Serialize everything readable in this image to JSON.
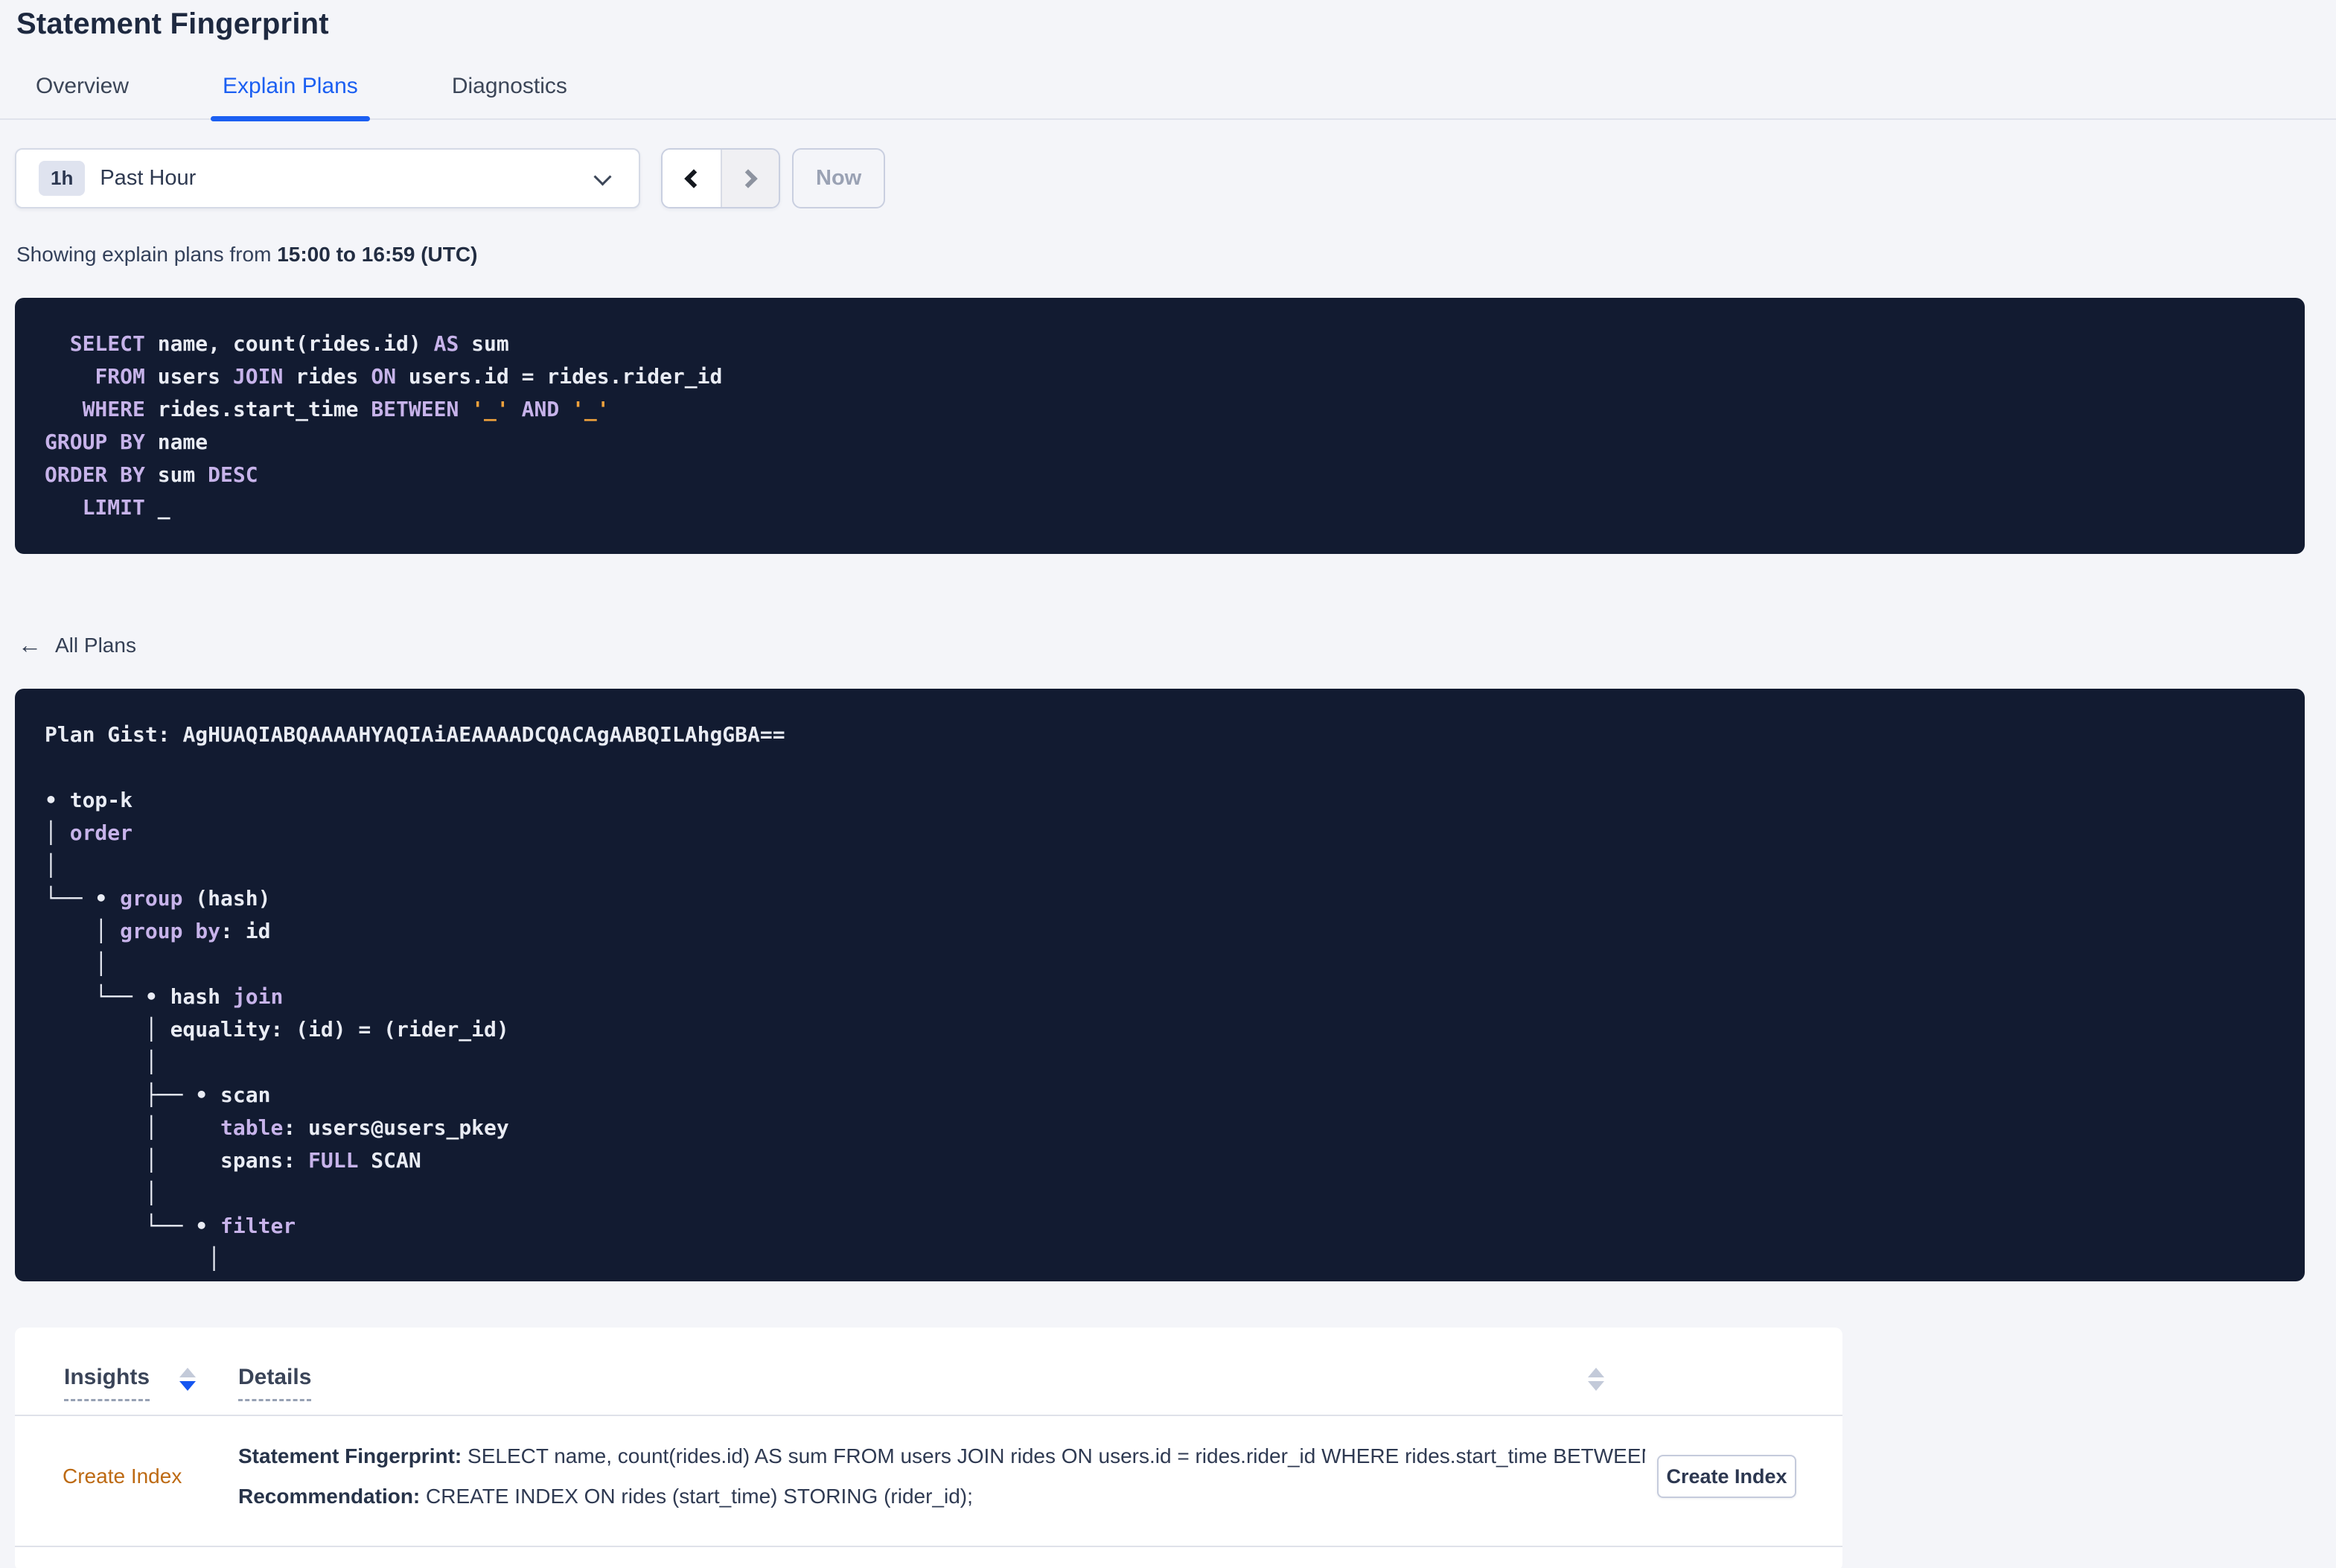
{
  "colors": {
    "accent_blue": "#1b5ff2",
    "panel_bg": "#121b31",
    "keyword_purple": "#c7b3ea",
    "literal_orange": "#f0a23c",
    "insight_orange": "#bd6a13"
  },
  "header": {
    "title": "Statement Fingerprint"
  },
  "tabs": [
    {
      "label": "Overview",
      "active": false
    },
    {
      "label": "Explain Plans",
      "active": true
    },
    {
      "label": "Diagnostics",
      "active": false
    }
  ],
  "time_selector": {
    "badge": "1h",
    "label": "Past Hour",
    "prev_label": "previous time interval",
    "next_label": "next time interval",
    "now_label": "Now"
  },
  "caption": {
    "prefix": "Showing explain plans from ",
    "range": "15:00 to 16:59 (UTC)"
  },
  "sql": {
    "lines": [
      [
        [
          "t",
          "  "
        ],
        [
          "k",
          "SELECT"
        ],
        [
          "t",
          " name, count(rides.id) "
        ],
        [
          "k",
          "AS"
        ],
        [
          "t",
          " sum"
        ]
      ],
      [
        [
          "t",
          "    "
        ],
        [
          "k",
          "FROM"
        ],
        [
          "t",
          " users "
        ],
        [
          "k",
          "JOIN"
        ],
        [
          "t",
          " rides "
        ],
        [
          "k",
          "ON"
        ],
        [
          "t",
          " users.id = rides.rider_id"
        ]
      ],
      [
        [
          "t",
          "   "
        ],
        [
          "k",
          "WHERE"
        ],
        [
          "t",
          " rides.start_time "
        ],
        [
          "k",
          "BETWEEN"
        ],
        [
          "t",
          " "
        ],
        [
          "s",
          "'_'"
        ],
        [
          "t",
          " "
        ],
        [
          "k",
          "AND"
        ],
        [
          "t",
          " "
        ],
        [
          "s",
          "'_'"
        ]
      ],
      [
        [
          "k",
          "GROUP BY"
        ],
        [
          "t",
          " name"
        ]
      ],
      [
        [
          "k",
          "ORDER BY"
        ],
        [
          "t",
          " sum "
        ],
        [
          "k",
          "DESC"
        ]
      ],
      [
        [
          "t",
          "   "
        ],
        [
          "k",
          "LIMIT"
        ],
        [
          "t",
          " _"
        ]
      ]
    ]
  },
  "all_plans": {
    "label": "All Plans"
  },
  "plan": {
    "gist_label": "Plan Gist: ",
    "gist_value": "AgHUAQIABQAAAAHYAQIAiAEAAAADCQACAgAABQILAhgGBA==",
    "tree_lines": [
      [
        [
          "t",
          "• top-k"
        ]
      ],
      [
        [
          "t",
          "│ "
        ],
        [
          "k",
          "order"
        ]
      ],
      [
        [
          "t",
          "│"
        ]
      ],
      [
        [
          "t",
          "└── • "
        ],
        [
          "k",
          "group"
        ],
        [
          "t",
          " (hash)"
        ]
      ],
      [
        [
          "t",
          "    │ "
        ],
        [
          "k",
          "group by"
        ],
        [
          "t",
          ": id"
        ]
      ],
      [
        [
          "t",
          "    │"
        ]
      ],
      [
        [
          "t",
          "    └── • hash "
        ],
        [
          "k",
          "join"
        ]
      ],
      [
        [
          "t",
          "        │ equality: (id) = (rider_id)"
        ]
      ],
      [
        [
          "t",
          "        │"
        ]
      ],
      [
        [
          "t",
          "        ├── • scan"
        ]
      ],
      [
        [
          "t",
          "        │     "
        ],
        [
          "k",
          "table"
        ],
        [
          "t",
          ": users@users_pkey"
        ]
      ],
      [
        [
          "t",
          "        │     spans: "
        ],
        [
          "k",
          "FULL"
        ],
        [
          "t",
          " SCAN"
        ]
      ],
      [
        [
          "t",
          "        │"
        ]
      ],
      [
        [
          "t",
          "        └── • "
        ],
        [
          "k",
          "filter"
        ]
      ],
      [
        [
          "t",
          "             │"
        ]
      ]
    ]
  },
  "insights_table": {
    "headers": {
      "insights": "Insights",
      "details": "Details"
    },
    "row": {
      "insight": "Create Index",
      "statement_label": "Statement Fingerprint:",
      "statement_text": " SELECT name, count(rides.id) AS sum FROM users JOIN rides ON users.id = rides.rider_id WHERE rides.start_time BETWEEN '_…",
      "recommendation_label": "Recommendation:",
      "recommendation_text": " CREATE INDEX ON rides (start_time) STORING (rider_id);",
      "button_label": "Create Index"
    }
  }
}
